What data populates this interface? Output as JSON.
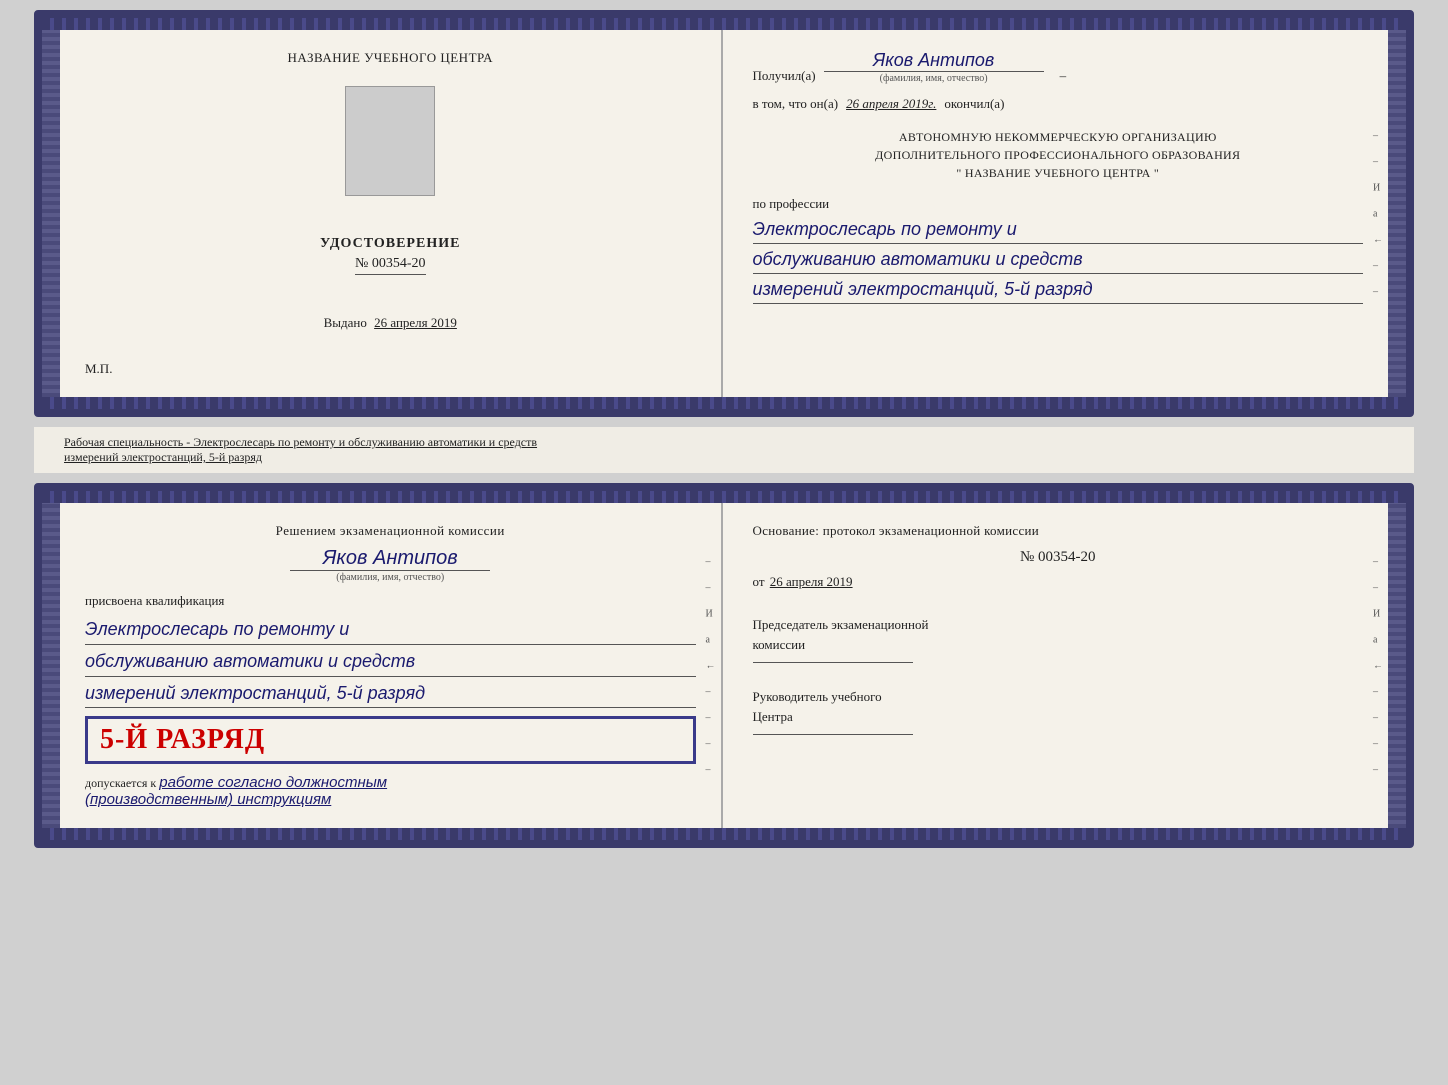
{
  "doc1": {
    "left": {
      "center_title": "НАЗВАНИЕ УЧЕБНОГО ЦЕНТРА",
      "udostoverenie": "УДОСТОВЕРЕНИЕ",
      "number": "№ 00354-20",
      "vydano_label": "Выдано",
      "vydano_date": "26 апреля 2019",
      "mp": "М.П."
    },
    "right": {
      "poluchil_label": "Получил(а)",
      "fio_value": "Яков Антипов",
      "fio_subtitle": "(фамилия, имя, отчество)",
      "vtom_label": "в том, что он(а)",
      "vtom_date": "26 апреля 2019г.",
      "okonchil": "окончил(а)",
      "org_line1": "АВТОНОМНУЮ НЕКОММЕРЧЕСКУЮ ОРГАНИЗАЦИЮ",
      "org_line2": "ДОПОЛНИТЕЛЬНОГО ПРОФЕССИОНАЛЬНОГО ОБРАЗОВАНИЯ",
      "org_line3": "\"    НАЗВАНИЕ УЧЕБНОГО ЦЕНТРА    \"",
      "po_professii": "по профессии",
      "profession1": "Электрослесарь по ремонту и",
      "profession2": "обслуживанию автоматики и средств",
      "profession3": "измерений электростанций, 5-й разряд"
    }
  },
  "info_bar": {
    "text1": "Рабочая специальность - Электрослесарь по ремонту и обслуживанию автоматики и средств",
    "text2": "измерений электростанций, 5-й разряд"
  },
  "doc2": {
    "left": {
      "resheniem": "Решением экзаменационной комиссии",
      "fio_value": "Яков Антипов",
      "fio_subtitle": "(фамилия, имя, отчество)",
      "prisvoena": "присвоена квалификация",
      "kval1": "Электрослесарь по ремонту и",
      "kval2": "обслуживанию автоматики и средств",
      "kval3": "измерений электростанций, 5-й разряд",
      "razryad": "5-й разряд",
      "dopuskaetsya_label": "допускается к",
      "dopuskaetsya_val": "работе согласно должностным",
      "dopuskaetsya_val2": "(производственным) инструкциям"
    },
    "right": {
      "osnovanie": "Основание: протокол экзаменационной  комиссии",
      "protocol_num": "№  00354-20",
      "ot_label": "от",
      "ot_date": "26 апреля 2019",
      "predsedatel": "Председатель экзаменационной",
      "komissia": "комиссии",
      "rukovoditel": "Руководитель учебного",
      "centra": "Центра"
    }
  }
}
